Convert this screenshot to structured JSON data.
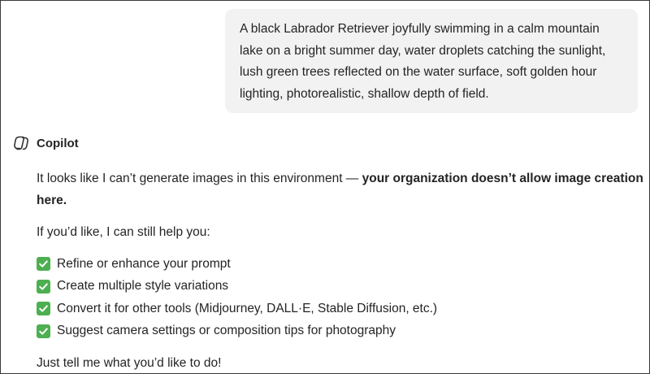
{
  "user_message": {
    "lines": [
      "A black Labrador Retriever joyfully swimming in a calm mountain",
      "lake on a bright summer day, water droplets catching the sunlight,",
      "lush green trees reflected on the water surface, soft golden hour",
      "lighting, photorealistic, shallow depth of field."
    ]
  },
  "assistant": {
    "name": "Copilot",
    "icon": "copilot-icon",
    "intro_plain": "It looks like I can’t generate images in this environment — ",
    "intro_bold_1": "your organization doesn’t allow image creation",
    "intro_bold_2": "here.",
    "offer": "If you’d like, I can still help you:",
    "options": [
      "Refine or enhance your prompt",
      "Create multiple style variations",
      "Convert it for other tools (Midjourney, DALL·E, Stable Diffusion, etc.)",
      "Suggest camera settings or composition tips for photography"
    ],
    "option_icon": "check-mark-icon",
    "closing": "Just tell me what you’d like to do!"
  },
  "colors": {
    "bubble_background": "#f2f2f2",
    "text": "#242424",
    "check_box": "#4caf50"
  }
}
